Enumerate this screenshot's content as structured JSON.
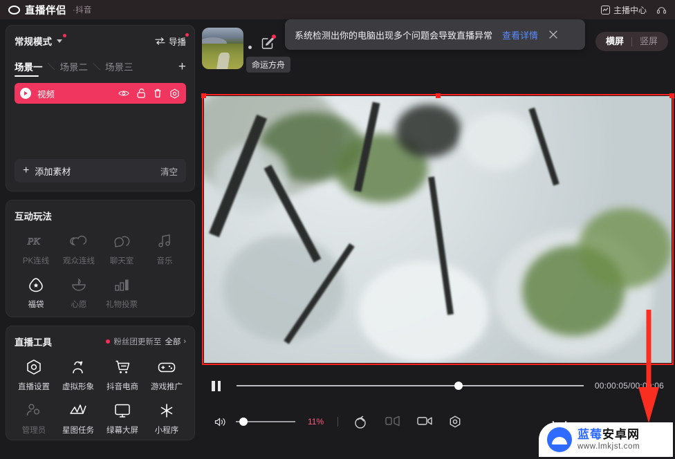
{
  "titlebar": {
    "app_name": "直播伴侣",
    "app_sub": "·抖音",
    "anchor_center": "主播中心",
    "logo_icon": "ring-logo-icon",
    "anchor_icon": "anchor-center-icon",
    "support_icon": "headset-icon"
  },
  "scene_panel": {
    "mode_label": "常规模式",
    "director_label": "导播",
    "tabs": [
      {
        "label": "场景一",
        "active": true
      },
      {
        "label": "场景二",
        "active": false
      },
      {
        "label": "场景三",
        "active": false
      }
    ],
    "tab_separator": "＼",
    "add_scene_label": "+",
    "layer": {
      "name": "视频",
      "icons": [
        "eye-icon",
        "unlock-icon",
        "trash-icon",
        "settings-icon"
      ]
    },
    "add_material_label": "添加素材",
    "clear_label": "清空"
  },
  "interactive": {
    "title": "互动玩法",
    "items": [
      {
        "label": "PK连线",
        "icon": "pk-icon",
        "dim": true
      },
      {
        "label": "观众连线",
        "icon": "audience-link-icon",
        "dim": true
      },
      {
        "label": "聊天室",
        "icon": "chat-room-icon",
        "dim": true
      },
      {
        "label": "音乐",
        "icon": "music-icon",
        "dim": true
      },
      {
        "label": "福袋",
        "icon": "lucky-bag-icon",
        "dim": false
      },
      {
        "label": "心愿",
        "icon": "wish-icon",
        "dim": true
      },
      {
        "label": "礼物投票",
        "icon": "gift-vote-icon",
        "dim": true
      }
    ]
  },
  "live_tools": {
    "title": "直播工具",
    "update_note": "粉丝团更新至",
    "all_label": "全部",
    "chevron": "›",
    "items": [
      {
        "label": "直播设置",
        "icon": "live-settings-icon",
        "dim": false
      },
      {
        "label": "虚拟形象",
        "icon": "avatar-icon",
        "dim": false
      },
      {
        "label": "抖音电商",
        "icon": "cart-icon",
        "dim": false
      },
      {
        "label": "游戏推广",
        "icon": "gamepad-icon",
        "dim": false
      },
      {
        "label": "管理员",
        "icon": "admin-icon",
        "dim": true
      },
      {
        "label": "星图任务",
        "icon": "star-map-icon",
        "dim": false
      },
      {
        "label": "绿幕大屏",
        "icon": "monitor-icon",
        "dim": false
      },
      {
        "label": "小程序",
        "icon": "mini-program-icon",
        "dim": false
      }
    ]
  },
  "preview": {
    "room_name": "命运方舟",
    "edit_icon": "edit-icon",
    "thumbnail_icon": "room-cover-thumbnail",
    "orientation": {
      "landscape": "横屏",
      "portrait": "竖屏",
      "selected": "横屏"
    }
  },
  "banner": {
    "message": "系统检测出你的电脑出现多个问题会导致直播异常",
    "link": "查看详情",
    "close_icon": "close-icon"
  },
  "player": {
    "pause_icon": "pause-icon",
    "time": "00:00:05/00:00:06",
    "progress_percent": 64,
    "volume_icon": "volume-icon",
    "volume_percent": "11%",
    "volume_value": 11,
    "controls": [
      {
        "icon": "rotate-icon",
        "dim": false
      },
      {
        "icon": "flip-icon",
        "dim": true
      },
      {
        "icon": "crop-icon",
        "dim": false
      },
      {
        "icon": "gear-icon",
        "dim": false
      }
    ]
  },
  "annotation": {
    "arrow_icon": "red-down-arrow"
  },
  "watermark": {
    "name_blue": "蓝莓",
    "name_black": "安卓网",
    "url": "www.lmkjst.com",
    "logo_icon": "android-logo-icon"
  },
  "colors": {
    "accent_pink": "#f0365e",
    "badge_red": "#fa2c55",
    "link_blue": "#5b8cff",
    "selection_red": "#ff2020",
    "panel_bg": "#262629",
    "app_bg": "#1b1b1e"
  }
}
